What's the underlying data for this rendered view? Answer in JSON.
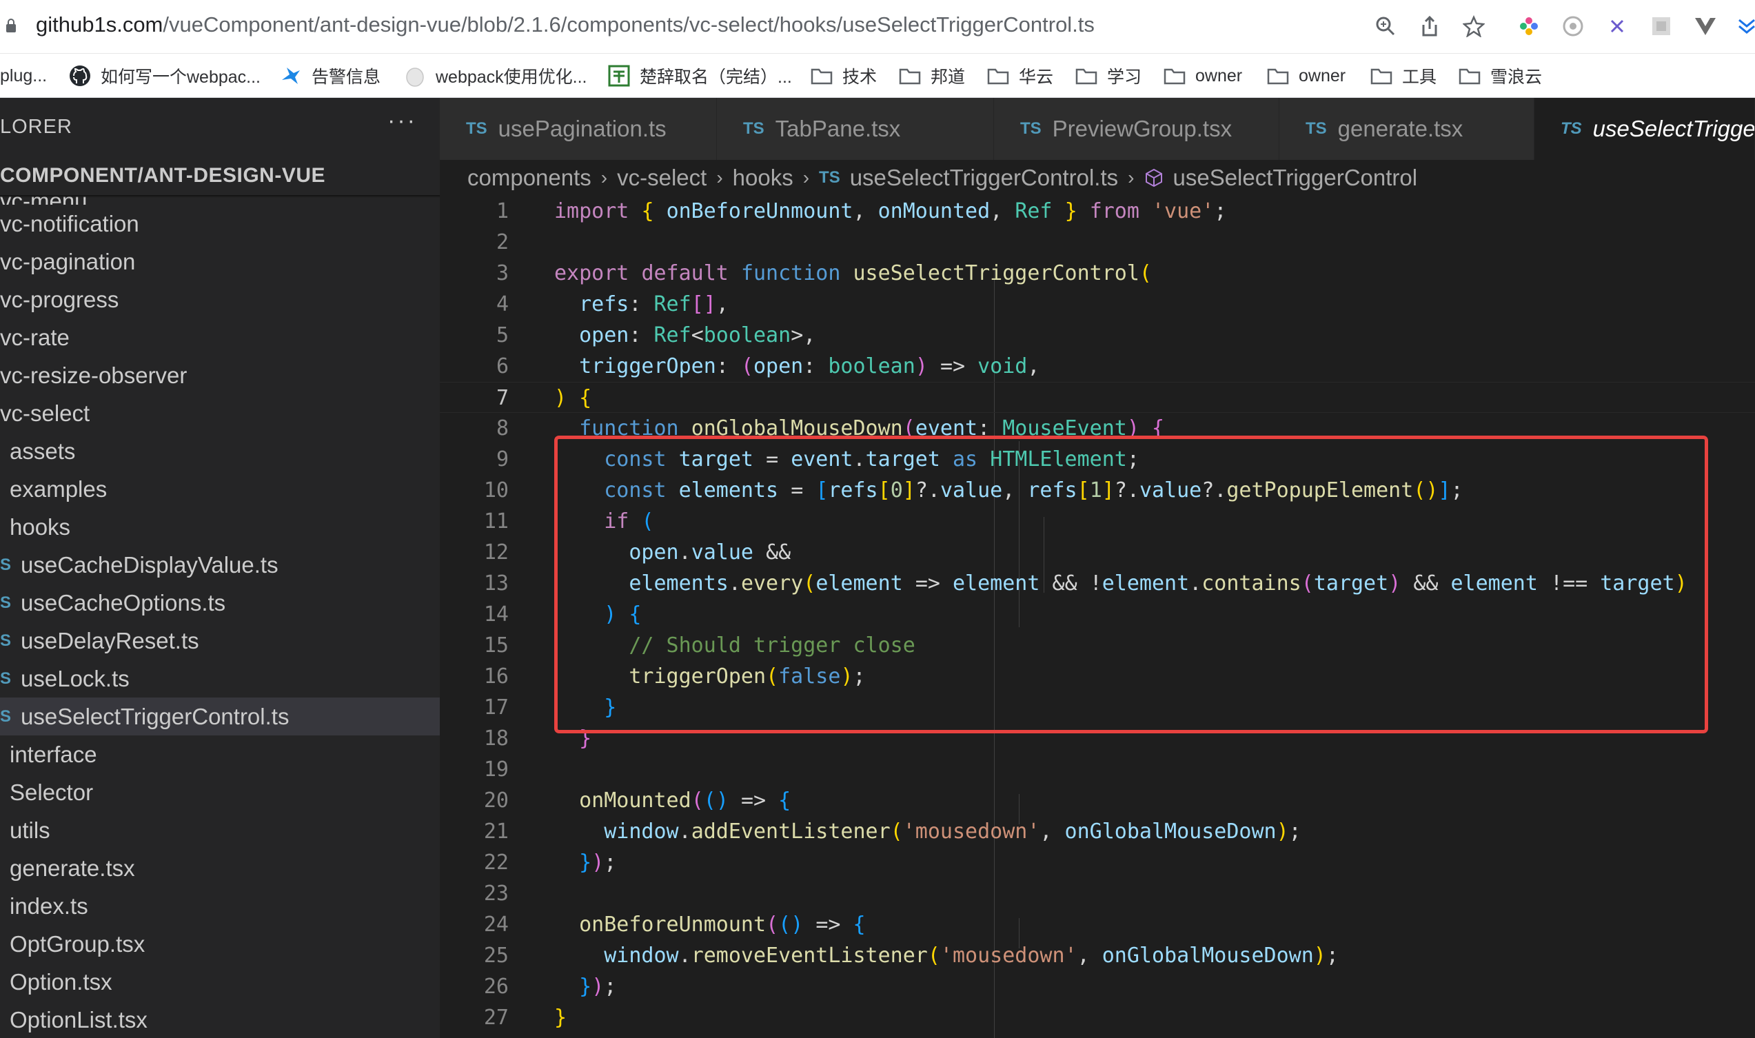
{
  "browser": {
    "url_host": "github1s.com",
    "url_path": "/vueComponent/ant-design-vue/blob/2.1.6/components/vc-select/hooks/useSelectTriggerControl.ts",
    "bookmarks": [
      {
        "label": "plug...",
        "icon": "none"
      },
      {
        "label": "如何写一个webpac...",
        "icon": "github-icon"
      },
      {
        "label": "告警信息",
        "icon": "bird-icon"
      },
      {
        "label": "webpack使用优化...",
        "icon": "egg-icon"
      },
      {
        "label": "楚辞取名（完结）...",
        "icon": "book-icon"
      },
      {
        "label": "技术",
        "icon": "folder-icon"
      },
      {
        "label": "邦道",
        "icon": "folder-icon"
      },
      {
        "label": "华云",
        "icon": "folder-icon"
      },
      {
        "label": "学习",
        "icon": "folder-icon"
      },
      {
        "label": "owner",
        "icon": "folder-icon"
      },
      {
        "label": "owner",
        "icon": "folder-icon"
      },
      {
        "label": "工具",
        "icon": "folder-icon"
      },
      {
        "label": "雪浪云",
        "icon": "folder-icon"
      }
    ]
  },
  "sidebar": {
    "title": "LORER",
    "more": "···",
    "root": "COMPONENT/ANT-DESIGN-VUE",
    "items": [
      {
        "label": "vc-menu",
        "badge": ""
      },
      {
        "label": "vc-notification",
        "badge": ""
      },
      {
        "label": "vc-pagination",
        "badge": ""
      },
      {
        "label": "vc-progress",
        "badge": ""
      },
      {
        "label": "vc-rate",
        "badge": ""
      },
      {
        "label": "vc-resize-observer",
        "badge": ""
      },
      {
        "label": "vc-select",
        "badge": ""
      },
      {
        "label": "assets",
        "badge": ""
      },
      {
        "label": "examples",
        "badge": ""
      },
      {
        "label": "hooks",
        "badge": ""
      },
      {
        "label": "useCacheDisplayValue.ts",
        "badge": "S"
      },
      {
        "label": "useCacheOptions.ts",
        "badge": "S"
      },
      {
        "label": "useDelayReset.ts",
        "badge": "S"
      },
      {
        "label": "useLock.ts",
        "badge": "S"
      },
      {
        "label": "useSelectTriggerControl.ts",
        "badge": "S"
      },
      {
        "label": "interface",
        "badge": ""
      },
      {
        "label": "Selector",
        "badge": ""
      },
      {
        "label": "utils",
        "badge": ""
      },
      {
        "label": "generate.tsx",
        "badge": ""
      },
      {
        "label": "index.ts",
        "badge": ""
      },
      {
        "label": "OptGroup.tsx",
        "badge": ""
      },
      {
        "label": "Option.tsx",
        "badge": ""
      },
      {
        "label": "OptionList.tsx",
        "badge": ""
      }
    ]
  },
  "tabs": [
    {
      "badge": "TS",
      "label": "usePagination.ts"
    },
    {
      "badge": "TS",
      "label": "TabPane.tsx"
    },
    {
      "badge": "TS",
      "label": "PreviewGroup.tsx"
    },
    {
      "badge": "TS",
      "label": "generate.tsx"
    },
    {
      "badge": "TS",
      "label": "useSelectTriggerCont"
    }
  ],
  "breadcrumb": {
    "parts": [
      "components",
      "vc-select",
      "hooks"
    ],
    "file_badge": "TS",
    "file": "useSelectTriggerControl.ts",
    "symbol": "useSelectTriggerControl"
  },
  "code": {
    "line_numbers": [
      "1",
      "2",
      "3",
      "4",
      "5",
      "6",
      "7",
      "8",
      "9",
      "10",
      "11",
      "12",
      "13",
      "14",
      "15",
      "16",
      "17",
      "18",
      "19",
      "20",
      "21",
      "22",
      "23",
      "24",
      "25",
      "26",
      "27"
    ],
    "lines": [
      "import { onBeforeUnmount, onMounted, Ref } from 'vue';",
      "",
      "export default function useSelectTriggerControl(",
      "  refs: Ref[],",
      "  open: Ref<boolean>,",
      "  triggerOpen: (open: boolean) => void,",
      ") {",
      "  function onGlobalMouseDown(event: MouseEvent) {",
      "    const target = event.target as HTMLElement;",
      "    const elements = [refs[0]?.value, refs[1]?.value?.getPopupElement()];",
      "    if (",
      "      open.value &&",
      "      elements.every(element => element && !element.contains(target) && element !== target)",
      "    ) {",
      "      // Should trigger close",
      "      triggerOpen(false);",
      "    }",
      "  }",
      "",
      "  onMounted(() => {",
      "    window.addEventListener('mousedown', onGlobalMouseDown);",
      "  });",
      "",
      "  onBeforeUnmount(() => {",
      "    window.removeEventListener('mousedown', onGlobalMouseDown);",
      "  });",
      "}"
    ]
  },
  "colors": {
    "highlight_border": "#e8423f",
    "ts_badge": "#519aba",
    "editor_bg": "#1e1e1e",
    "sidebar_bg": "#252526"
  }
}
